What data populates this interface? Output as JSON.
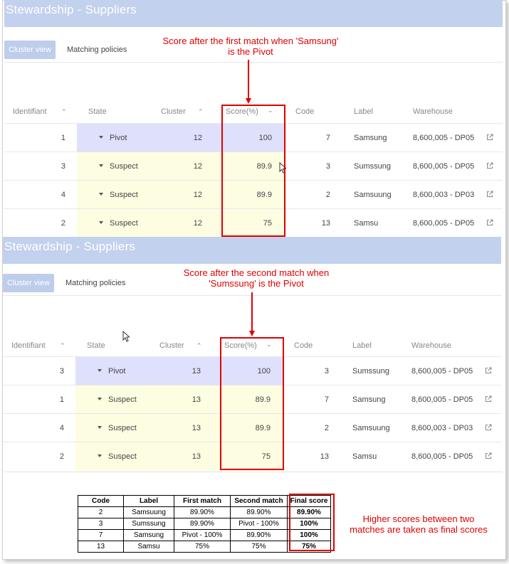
{
  "header": {
    "title": "Stewardship - Suppliers"
  },
  "tabs": {
    "cluster_view": "Cluster view",
    "matching_policies": "Matching policies"
  },
  "columns": {
    "identifiant": "Identifiant",
    "state": "State",
    "cluster": "Cluster",
    "score": "Score(%)",
    "code": "Code",
    "label": "Label",
    "warehouse": "Warehouse"
  },
  "panel1": {
    "annotation_line1": "Score after the first match when 'Samsung'",
    "annotation_line2": "is the Pivot",
    "rows": [
      {
        "id": "1",
        "state": "Pivot",
        "cluster": "12",
        "score": "100",
        "code": "7",
        "label": "Samsung",
        "warehouse": "8,600,005 - DP05"
      },
      {
        "id": "3",
        "state": "Suspect",
        "cluster": "12",
        "score": "89.9",
        "code": "3",
        "label": "Sumssung",
        "warehouse": "8,600,005 - DP05"
      },
      {
        "id": "4",
        "state": "Suspect",
        "cluster": "12",
        "score": "89.9",
        "code": "2",
        "label": "Samsuung",
        "warehouse": "8,600,003 - DP03"
      },
      {
        "id": "2",
        "state": "Suspect",
        "cluster": "12",
        "score": "75",
        "code": "13",
        "label": "Samsu",
        "warehouse": "8,600,005 - DP05"
      }
    ]
  },
  "panel2": {
    "annotation_line1": "Score after the second match when",
    "annotation_line2": "'Sumssung' is the Pivot",
    "rows": [
      {
        "id": "3",
        "state": "Pivot",
        "cluster": "13",
        "score": "100",
        "code": "3",
        "label": "Sumssung",
        "warehouse": "8,600,005 - DP05"
      },
      {
        "id": "1",
        "state": "Suspect",
        "cluster": "13",
        "score": "89.9",
        "code": "7",
        "label": "Samsung",
        "warehouse": "8,600,005 - DP05"
      },
      {
        "id": "4",
        "state": "Suspect",
        "cluster": "13",
        "score": "89.9",
        "code": "2",
        "label": "Samsuung",
        "warehouse": "8,600,003 - DP03"
      },
      {
        "id": "2",
        "state": "Suspect",
        "cluster": "13",
        "score": "75",
        "code": "13",
        "label": "Samsu",
        "warehouse": "8,600,005 - DP05"
      }
    ]
  },
  "summary": {
    "headers": [
      "Code",
      "Label",
      "First match",
      "Second match",
      "Final score"
    ],
    "rows": [
      [
        "2",
        "Samsuung",
        "89.90%",
        "89.90%",
        "89.90%"
      ],
      [
        "3",
        "Sumssung",
        "89.90%",
        "Pivot - 100%",
        "100%"
      ],
      [
        "7",
        "Samsung",
        "Pivot - 100%",
        "89.90%",
        "100%"
      ],
      [
        "13",
        "Samsu",
        "75%",
        "75%",
        "75%"
      ]
    ],
    "note_line1": "Higher scores between two",
    "note_line2": "matches are taken as final scores"
  },
  "colors": {
    "header_bg": "#c2d1ed",
    "pivot_bg": "#dfe0fb",
    "suspect_bg": "#fdfde2",
    "annotation_red": "#e00000"
  },
  "icons": {
    "external_link": "external-link-icon",
    "sort": "chevron-icon",
    "dropdown": "triangle-down-icon",
    "cursor": "mouse-cursor-icon"
  }
}
